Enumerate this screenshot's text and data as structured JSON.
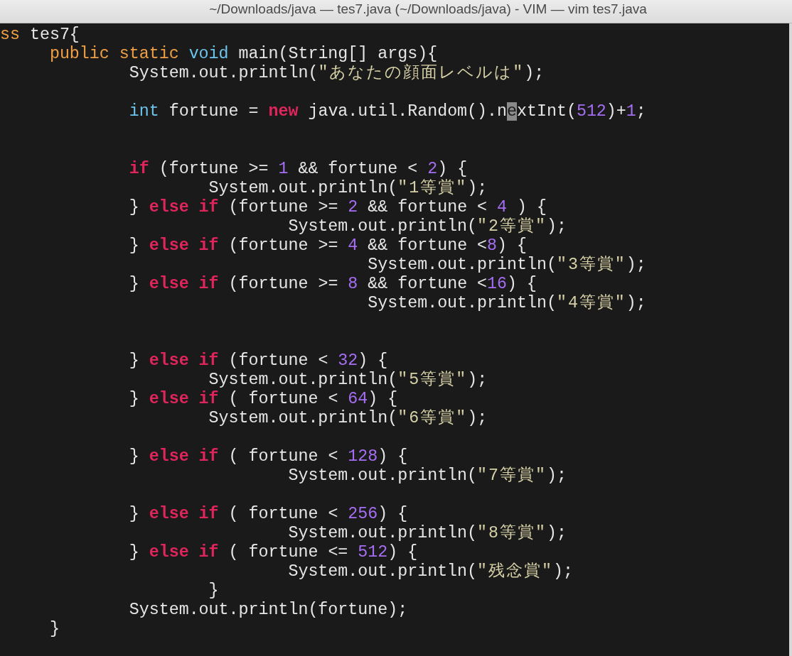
{
  "window": {
    "title": "~/Downloads/java — tes7.java (~/Downloads/java) - VIM — vim tes7.java"
  },
  "lines": [
    {
      "kind": "code",
      "tokens": [
        {
          "kind": "keyword",
          "text": "ss"
        },
        {
          "kind": "plain",
          "text": " tes7{"
        }
      ]
    },
    {
      "kind": "code",
      "tokens": [
        {
          "kind": "keyword",
          "text": "     public static"
        },
        {
          "kind": "type",
          "text": " void"
        },
        {
          "kind": "plain",
          "text": " main(String[] args){"
        }
      ]
    },
    {
      "kind": "code",
      "tokens": [
        {
          "kind": "plain",
          "text": "             System.out.println("
        },
        {
          "kind": "string",
          "text": "\"あなたの顔面レベルは\""
        },
        {
          "kind": "plain",
          "text": ");"
        }
      ]
    },
    {
      "kind": "blank"
    },
    {
      "kind": "code",
      "tokens": [
        {
          "kind": "type",
          "text": "             int"
        },
        {
          "kind": "plain",
          "text": " fortune = "
        },
        {
          "kind": "control",
          "text": "new"
        },
        {
          "kind": "plain",
          "text": " java.util.Random().n"
        },
        {
          "kind": "cursor",
          "text": "e"
        },
        {
          "kind": "plain",
          "text": "xtInt("
        },
        {
          "kind": "number",
          "text": "512"
        },
        {
          "kind": "plain",
          "text": ")+"
        },
        {
          "kind": "number",
          "text": "1"
        },
        {
          "kind": "plain",
          "text": ";"
        }
      ]
    },
    {
      "kind": "blank"
    },
    {
      "kind": "blank"
    },
    {
      "kind": "code",
      "tokens": [
        {
          "kind": "control",
          "text": "             if"
        },
        {
          "kind": "plain",
          "text": " (fortune >= "
        },
        {
          "kind": "number",
          "text": "1"
        },
        {
          "kind": "plain",
          "text": " && fortune < "
        },
        {
          "kind": "number",
          "text": "2"
        },
        {
          "kind": "plain",
          "text": ") {"
        }
      ]
    },
    {
      "kind": "code",
      "tokens": [
        {
          "kind": "plain",
          "text": "                     System.out.println("
        },
        {
          "kind": "string",
          "text": "\"1等賞\""
        },
        {
          "kind": "plain",
          "text": ");"
        }
      ]
    },
    {
      "kind": "code",
      "tokens": [
        {
          "kind": "plain",
          "text": "             } "
        },
        {
          "kind": "control",
          "text": "else if"
        },
        {
          "kind": "plain",
          "text": " (fortune >= "
        },
        {
          "kind": "number",
          "text": "2"
        },
        {
          "kind": "plain",
          "text": " && fortune < "
        },
        {
          "kind": "number",
          "text": "4"
        },
        {
          "kind": "plain",
          "text": " ) {"
        }
      ]
    },
    {
      "kind": "code",
      "tokens": [
        {
          "kind": "plain",
          "text": "                             System.out.println("
        },
        {
          "kind": "string",
          "text": "\"2等賞\""
        },
        {
          "kind": "plain",
          "text": ");"
        }
      ]
    },
    {
      "kind": "code",
      "tokens": [
        {
          "kind": "plain",
          "text": "             } "
        },
        {
          "kind": "control",
          "text": "else if"
        },
        {
          "kind": "plain",
          "text": " (fortune >= "
        },
        {
          "kind": "number",
          "text": "4"
        },
        {
          "kind": "plain",
          "text": " && fortune <"
        },
        {
          "kind": "number",
          "text": "8"
        },
        {
          "kind": "plain",
          "text": ") {"
        }
      ]
    },
    {
      "kind": "code",
      "tokens": [
        {
          "kind": "plain",
          "text": "                                     System.out.println("
        },
        {
          "kind": "string",
          "text": "\"3等賞\""
        },
        {
          "kind": "plain",
          "text": ");"
        }
      ]
    },
    {
      "kind": "code",
      "tokens": [
        {
          "kind": "plain",
          "text": "             } "
        },
        {
          "kind": "control",
          "text": "else if"
        },
        {
          "kind": "plain",
          "text": " (fortune >= "
        },
        {
          "kind": "number",
          "text": "8"
        },
        {
          "kind": "plain",
          "text": " && fortune <"
        },
        {
          "kind": "number",
          "text": "16"
        },
        {
          "kind": "plain",
          "text": ") {"
        }
      ]
    },
    {
      "kind": "code",
      "tokens": [
        {
          "kind": "plain",
          "text": "                                     System.out.println("
        },
        {
          "kind": "string",
          "text": "\"4等賞\""
        },
        {
          "kind": "plain",
          "text": ");"
        }
      ]
    },
    {
      "kind": "blank"
    },
    {
      "kind": "blank"
    },
    {
      "kind": "code",
      "tokens": [
        {
          "kind": "plain",
          "text": "             } "
        },
        {
          "kind": "control",
          "text": "else if"
        },
        {
          "kind": "plain",
          "text": " (fortune < "
        },
        {
          "kind": "number",
          "text": "32"
        },
        {
          "kind": "plain",
          "text": ") {"
        }
      ]
    },
    {
      "kind": "code",
      "tokens": [
        {
          "kind": "plain",
          "text": "                     System.out.println("
        },
        {
          "kind": "string",
          "text": "\"5等賞\""
        },
        {
          "kind": "plain",
          "text": ");"
        }
      ]
    },
    {
      "kind": "code",
      "tokens": [
        {
          "kind": "plain",
          "text": "             } "
        },
        {
          "kind": "control",
          "text": "else if"
        },
        {
          "kind": "plain",
          "text": " ( fortune < "
        },
        {
          "kind": "number",
          "text": "64"
        },
        {
          "kind": "plain",
          "text": ") {"
        }
      ]
    },
    {
      "kind": "code",
      "tokens": [
        {
          "kind": "plain",
          "text": "                     System.out.println("
        },
        {
          "kind": "string",
          "text": "\"6等賞\""
        },
        {
          "kind": "plain",
          "text": ");"
        }
      ]
    },
    {
      "kind": "blank"
    },
    {
      "kind": "code",
      "tokens": [
        {
          "kind": "plain",
          "text": "             } "
        },
        {
          "kind": "control",
          "text": "else if"
        },
        {
          "kind": "plain",
          "text": " ( fortune < "
        },
        {
          "kind": "number",
          "text": "128"
        },
        {
          "kind": "plain",
          "text": ") {"
        }
      ]
    },
    {
      "kind": "code",
      "tokens": [
        {
          "kind": "plain",
          "text": "                             System.out.println("
        },
        {
          "kind": "string",
          "text": "\"7等賞\""
        },
        {
          "kind": "plain",
          "text": ");"
        }
      ]
    },
    {
      "kind": "blank"
    },
    {
      "kind": "code",
      "tokens": [
        {
          "kind": "plain",
          "text": "             } "
        },
        {
          "kind": "control",
          "text": "else if"
        },
        {
          "kind": "plain",
          "text": " ( fortune < "
        },
        {
          "kind": "number",
          "text": "256"
        },
        {
          "kind": "plain",
          "text": ") {"
        }
      ]
    },
    {
      "kind": "code",
      "tokens": [
        {
          "kind": "plain",
          "text": "                             System.out.println("
        },
        {
          "kind": "string",
          "text": "\"8等賞\""
        },
        {
          "kind": "plain",
          "text": ");"
        }
      ]
    },
    {
      "kind": "code",
      "tokens": [
        {
          "kind": "plain",
          "text": "             } "
        },
        {
          "kind": "control",
          "text": "else if"
        },
        {
          "kind": "plain",
          "text": " ( fortune <= "
        },
        {
          "kind": "number",
          "text": "512"
        },
        {
          "kind": "plain",
          "text": ") {"
        }
      ]
    },
    {
      "kind": "code",
      "tokens": [
        {
          "kind": "plain",
          "text": "                             System.out.println("
        },
        {
          "kind": "string",
          "text": "\"残念賞\""
        },
        {
          "kind": "plain",
          "text": ");"
        }
      ]
    },
    {
      "kind": "code",
      "tokens": [
        {
          "kind": "plain",
          "text": "                     }"
        }
      ]
    },
    {
      "kind": "code",
      "tokens": [
        {
          "kind": "plain",
          "text": "             System.out.println(fortune);"
        }
      ]
    },
    {
      "kind": "code",
      "tokens": [
        {
          "kind": "plain",
          "text": "     }"
        }
      ]
    }
  ]
}
